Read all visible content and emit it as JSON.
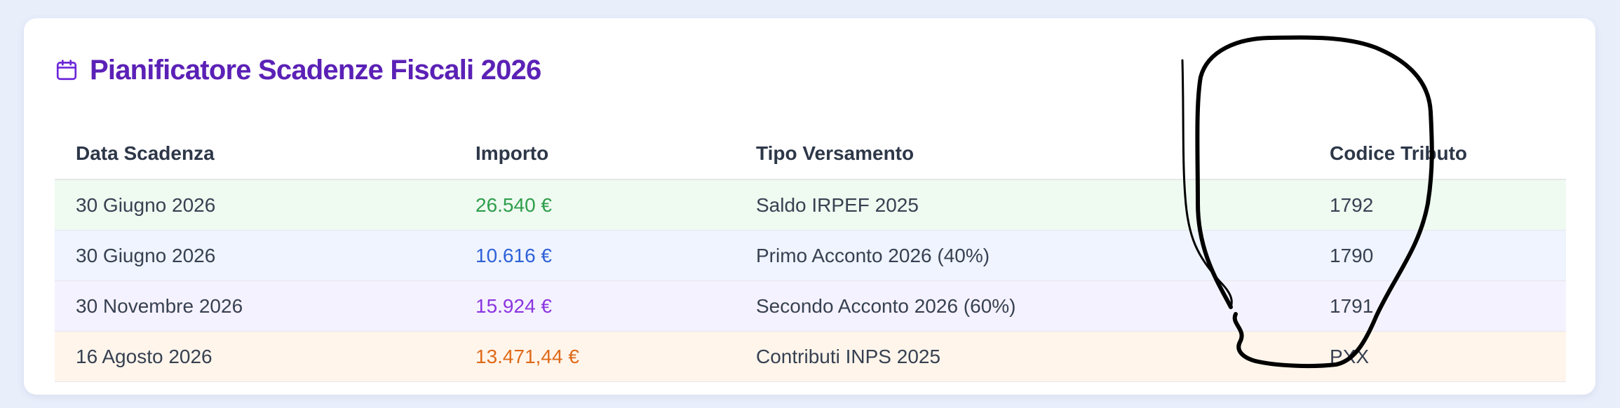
{
  "header": {
    "title": "Pianificatore Scadenze Fiscali 2026",
    "icon": "calendar-icon",
    "title_color": "#5b21b6"
  },
  "table": {
    "columns": [
      "Data Scadenza",
      "Importo",
      "Tipo Versamento",
      "Codice Tributo"
    ],
    "rows": [
      {
        "date": "30 Giugno 2026",
        "amount": "26.540 €",
        "type": "Saldo IRPEF 2025",
        "code": "1792",
        "amount_color": "#2e9e4b",
        "bg": "#effaf1"
      },
      {
        "date": "30 Giugno 2026",
        "amount": "10.616 €",
        "type": "Primo Acconto 2026 (40%)",
        "code": "1790",
        "amount_color": "#2f62d8",
        "bg": "#eff4ff"
      },
      {
        "date": "30 Novembre 2026",
        "amount": "15.924 €",
        "type": "Secondo Acconto 2026 (60%)",
        "code": "1791",
        "amount_color": "#8b35e0",
        "bg": "#f5f2ff"
      },
      {
        "date": "16 Agosto 2026",
        "amount": "13.471,44 €",
        "type": "Contributi INPS 2025",
        "code": "PXX",
        "amount_color": "#df6a1a",
        "bg": "#fff5eb"
      }
    ]
  },
  "annotation": {
    "kind": "hand-drawn-circle",
    "color": "#000000"
  }
}
